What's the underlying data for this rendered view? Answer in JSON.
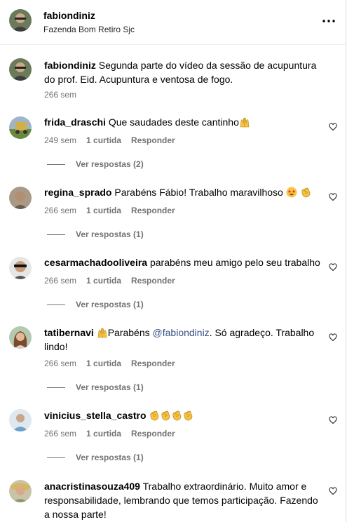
{
  "header": {
    "username": "fabiondiniz",
    "location": "Fazenda Bom Retiro Sjc",
    "more_icon": "more-horizontal-icon"
  },
  "caption": {
    "username": "fabiondiniz",
    "text": "Segunda parte do vídeo da sessão de acupuntura do prof. Eid. Acupuntura e ventosa de fogo.",
    "time": "266 sem"
  },
  "comments": [
    {
      "username": "frida_draschi",
      "text": "Que saudades deste cantinho",
      "time": "249 sem",
      "likes": "1 curtida",
      "reply": "Responder",
      "replies": "Ver respostas (2)"
    },
    {
      "username": "regina_sprado",
      "text": "Parabéns Fábio! Trabalho maravilhoso",
      "time": "266 sem",
      "likes": "1 curtida",
      "reply": "Responder",
      "replies": "Ver respostas (1)"
    },
    {
      "username": "cesarmachadooliveira",
      "text": "parabéns meu amigo pelo seu trabalho",
      "time": "266 sem",
      "likes": "1 curtida",
      "reply": "Responder",
      "replies": "Ver respostas (1)"
    },
    {
      "username": "tatibernavi",
      "text_before": "Parabéns",
      "mention": "@fabiondiniz",
      "text_after": ". Só agradeço. Trabalho lindo!",
      "time": "266 sem",
      "likes": "1 curtida",
      "reply": "Responder",
      "replies": "Ver respostas (1)"
    },
    {
      "username": "vinicius_stella_castro",
      "text": "",
      "time": "266 sem",
      "likes": "1 curtida",
      "reply": "Responder",
      "replies": "Ver respostas (1)"
    },
    {
      "username": "anacristinasouza409",
      "text": "Trabalho extraordinário. Muito amor e responsabilidade, lembrando que temos participação. Fazendo a nossa parte!"
    }
  ],
  "icons": {
    "like": "heart-outline-icon",
    "emoji_hands": "raising-hands-emoji",
    "emoji_clap": "clapping-hands-emoji",
    "emoji_star": "star-struck-emoji"
  }
}
